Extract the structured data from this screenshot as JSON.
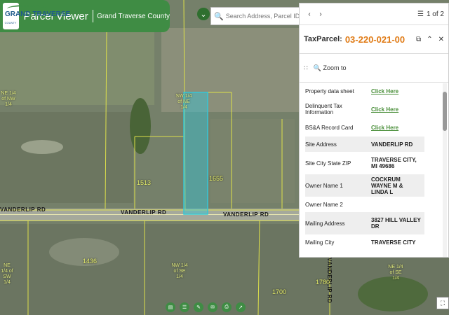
{
  "header": {
    "logo_text": "GRAND TRAVERSE",
    "logo_sub": "COUNTY",
    "title": "Parcel Viewer",
    "county": "Grand Traverse County"
  },
  "search": {
    "placeholder": "Search Address, Parcel ID, Owner"
  },
  "panel": {
    "pager": "1 of 2",
    "title_label": "TaxParcel:",
    "title_value": "03-220-021-00",
    "zoom_label": "Zoom to",
    "rows": [
      {
        "key": "Property data sheet",
        "value": "Click Here",
        "link": true
      },
      {
        "key": "Delinquent Tax Information",
        "value": "Click Here",
        "link": true
      },
      {
        "key": "BS&A Record Card",
        "value": "Click Here",
        "link": true
      },
      {
        "key": "Site Address",
        "value": "VANDERLIP RD"
      },
      {
        "key": "Site City State ZIP",
        "value": "TRAVERSE CITY, MI 49686"
      },
      {
        "key": "Owner Name 1",
        "value": "COCKRUM WAYNE M & LINDA L"
      },
      {
        "key": "Owner Name 2",
        "value": ""
      },
      {
        "key": "Mailing Address",
        "value": "3827 HILL VALLEY DR"
      },
      {
        "key": "Mailing City",
        "value": "TRAVERSE CITY"
      }
    ]
  },
  "map": {
    "road_labels": [
      "VANDERLIP RD",
      "VANDERLIP RD",
      "VANDERLIP RD",
      "VANDERLIP RD"
    ],
    "addresses": [
      "1513",
      "1655",
      "1436",
      "1700",
      "1780"
    ],
    "quarter_labels": [
      "NE 1/4 of NW 1/4",
      "SW 1/4 of NE 1/4",
      "NW 1/4 of SE 1/4",
      "NE 1/4 of SE 1/4",
      "NE 1/4 of SW 1/4"
    ]
  },
  "colors": {
    "brand_green": "#3f8c44",
    "parcel_highlight": "#36c6d6",
    "title_orange": "#e07b16"
  }
}
